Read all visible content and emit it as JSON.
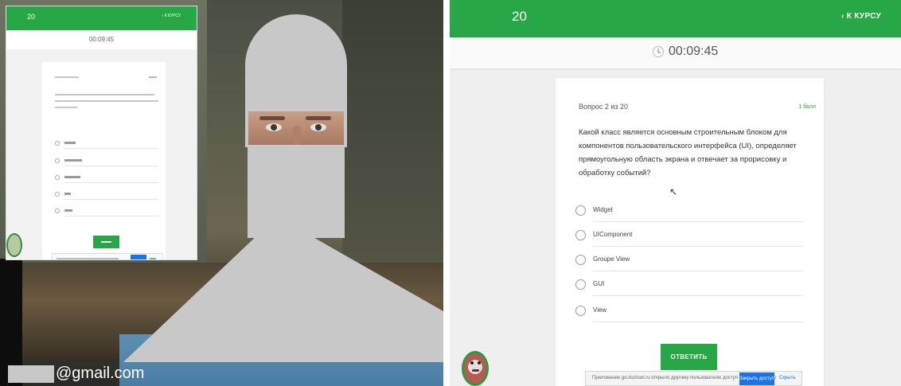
{
  "webcam": {
    "email": "@gmail.com"
  },
  "quiz": {
    "question_number": "20",
    "back_label": "‹ К КУРСУ",
    "timer": "00:09:45",
    "counter": "Вопрос 2 из 20",
    "link_label": "1 балл",
    "question_text": "Какой класс является основным строительным блоком для компонентов пользовательского интерфейса (UI), определяет прямоугольную область экрана и отвечает за прорисовку и обработку событий?",
    "options": [
      "Widget",
      "UIComponent",
      "Groupe View",
      "GUI",
      "View"
    ],
    "answer_label": "ОТВЕТИТЬ",
    "banner": {
      "message": "Приложение go.itschool.ru открыло другому пользователю доступ к вашему экрану",
      "share_label": "Закрыть доступ",
      "hide_label": "Скрыть"
    }
  },
  "colors": {
    "brand": "#27a745",
    "link_blue": "#1a73e8"
  }
}
